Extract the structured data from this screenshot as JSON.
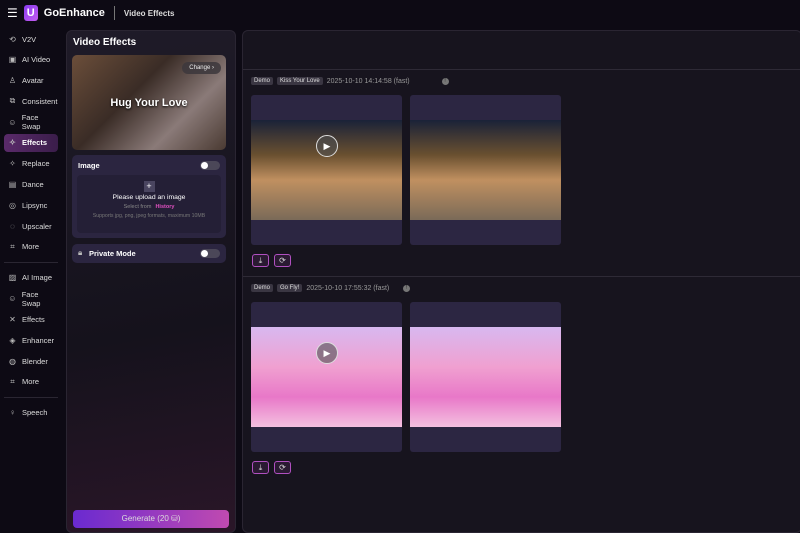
{
  "header": {
    "brand": "GoEnhance",
    "crumb": "Video Effects"
  },
  "sidebar": {
    "video_items": [
      {
        "label": "V2V",
        "icon": "v2v-icon"
      },
      {
        "label": "AI Video",
        "icon": "ai-video-icon"
      },
      {
        "label": "Avatar",
        "icon": "avatar-icon"
      },
      {
        "label": "Consistent",
        "icon": "consistent-icon"
      },
      {
        "label": "Face Swap",
        "icon": "face-swap-icon"
      },
      {
        "label": "Effects",
        "icon": "effects-icon"
      },
      {
        "label": "Replace",
        "icon": "replace-icon"
      },
      {
        "label": "Dance",
        "icon": "dance-icon"
      },
      {
        "label": "Lipsync",
        "icon": "lipsync-icon"
      },
      {
        "label": "Upscaler",
        "icon": "upscaler-icon"
      },
      {
        "label": "More",
        "icon": "more-icon"
      }
    ],
    "image_items": [
      {
        "label": "AI Image"
      },
      {
        "label": "Face Swap"
      },
      {
        "label": "Effects"
      },
      {
        "label": "Enhancer"
      },
      {
        "label": "Blender"
      },
      {
        "label": "More"
      }
    ],
    "audio_items": [
      {
        "label": "Speech"
      }
    ]
  },
  "panel": {
    "title": "Video Effects",
    "effect_name": "Hug Your Love",
    "change_label": "Change",
    "image_label": "Image",
    "upload_title": "Please upload an image",
    "select_from": "Select from",
    "history": "History",
    "formats": "Supports jpg, png, jpeg formats, maximum 10MB",
    "private_label": "Private Mode",
    "generate_label": "Generate (20 ⛁)"
  },
  "results": [
    {
      "tag1": "Demo",
      "tag2": "Kiss Your Love",
      "time": "2025-10-10 14:14:58 (fast)"
    },
    {
      "tag1": "Demo",
      "tag2": "Go Fly!",
      "time": "2025-10-10 17:55:32 (fast)"
    }
  ],
  "colors": {
    "accent": "#c04ab0",
    "active": "#5a2a6a"
  }
}
